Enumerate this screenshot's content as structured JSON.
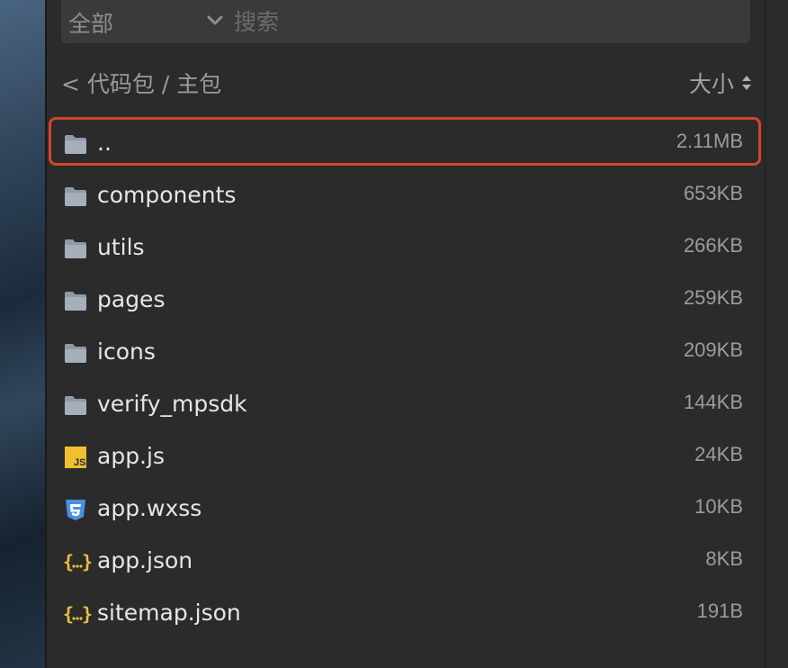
{
  "filter": {
    "scope_label": "全部",
    "search_placeholder": "搜索"
  },
  "breadcrumb": "< 代码包 / 主包",
  "sort": {
    "label": "大小"
  },
  "files": [
    {
      "name": "..",
      "size": "2.11MB",
      "icon": "folder-icon",
      "highlighted": true
    },
    {
      "name": "components",
      "size": "653KB",
      "icon": "folder-icon"
    },
    {
      "name": "utils",
      "size": "266KB",
      "icon": "folder-icon"
    },
    {
      "name": "pages",
      "size": "259KB",
      "icon": "folder-icon"
    },
    {
      "name": "icons",
      "size": "209KB",
      "icon": "folder-icon"
    },
    {
      "name": "verify_mpsdk",
      "size": "144KB",
      "icon": "folder-icon"
    },
    {
      "name": "app.js",
      "size": "24KB",
      "icon": "js-file-icon"
    },
    {
      "name": "app.wxss",
      "size": "10KB",
      "icon": "css-file-icon"
    },
    {
      "name": "app.json",
      "size": "8KB",
      "icon": "json-file-icon"
    },
    {
      "name": "sitemap.json",
      "size": "191B",
      "icon": "json-file-icon"
    }
  ],
  "colors": {
    "highlight": "#d6432a",
    "folder": "#8e9aa6",
    "js_badge": "#f0c030",
    "css_icon": "#4a90e2",
    "json_icon": "#e8c040"
  }
}
